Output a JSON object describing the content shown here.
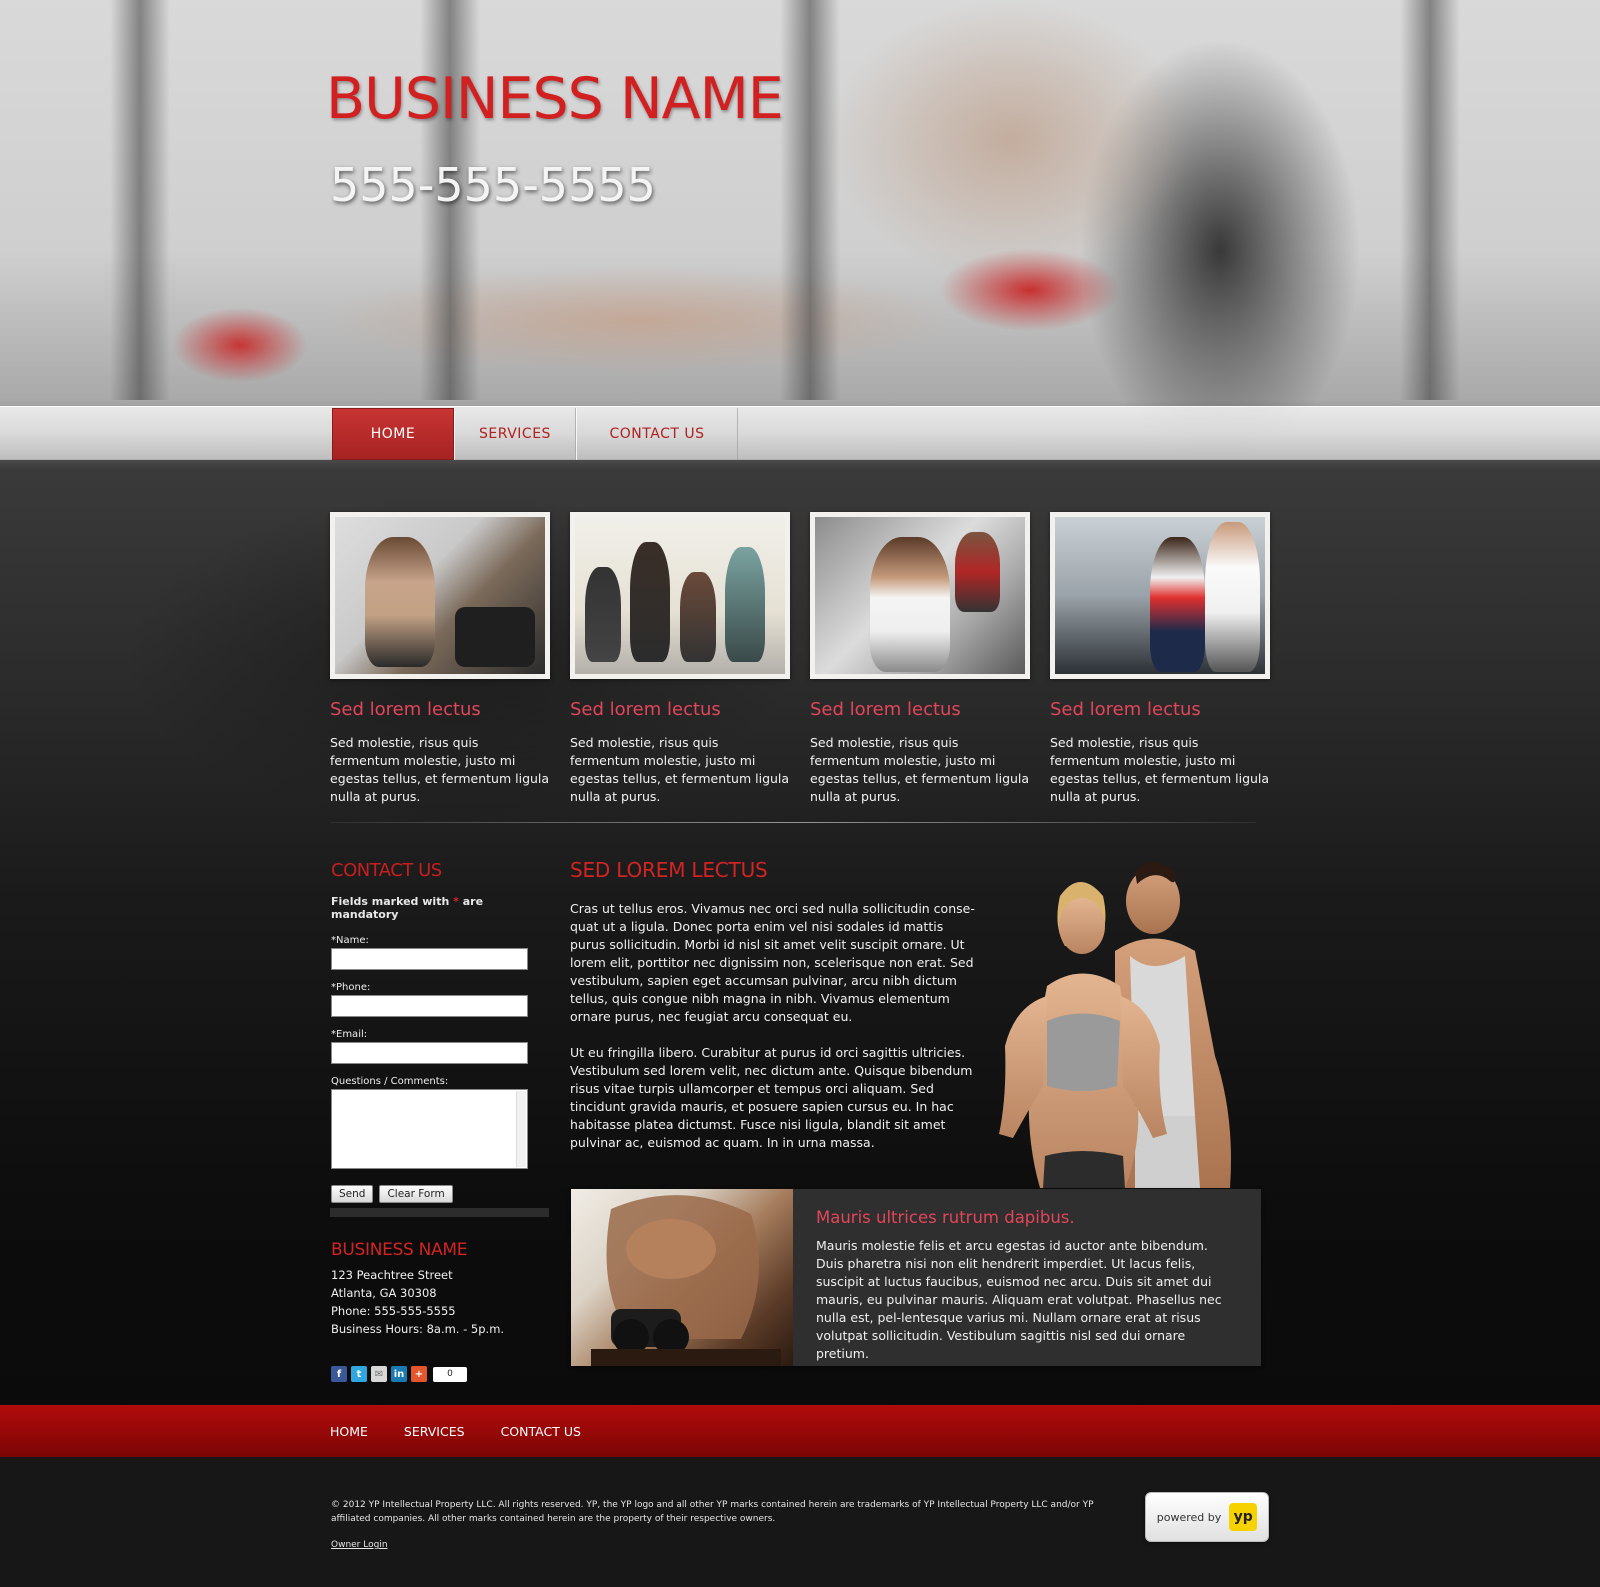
{
  "header": {
    "business_name": "BUSINESS NAME",
    "phone": "555-555-5555"
  },
  "nav": {
    "items": [
      {
        "label": "HOME",
        "active": true
      },
      {
        "label": "SERVICES",
        "active": false
      },
      {
        "label": "CONTACT US",
        "active": false
      }
    ]
  },
  "features": [
    {
      "title": "Sed lorem lectus",
      "text": "Sed molestie, risus quis fermentum molestie, justo mi egestas tellus, et fermentum ligula nulla at purus."
    },
    {
      "title": "Sed lorem lectus",
      "text": "Sed molestie, risus quis fermentum molestie, justo mi egestas tellus, et fermentum ligula nulla at purus."
    },
    {
      "title": "Sed lorem lectus",
      "text": "Sed molestie, risus quis fermentum molestie, justo mi egestas tellus, et fermentum ligula nulla at purus."
    },
    {
      "title": "Sed lorem lectus",
      "text": "Sed molestie, risus quis fermentum molestie, justo mi egestas tellus, et fermentum ligula nulla at purus."
    }
  ],
  "contact_form": {
    "heading": "CONTACT US",
    "mandatory_prefix": "Fields marked with ",
    "mandatory_star": "*",
    "mandatory_suffix": " are mandatory",
    "name_label": "*Name:",
    "phone_label": "*Phone:",
    "email_label": "*Email:",
    "comments_label": "Questions / Comments:",
    "send_label": "Send",
    "clear_label": "Clear Form"
  },
  "business_info": {
    "heading": "BUSINESS NAME",
    "street": "123 Peachtree Street",
    "city": "Atlanta, GA 30308",
    "phone": "Phone: 555-555-5555",
    "hours": "Business Hours: 8a.m. - 5p.m."
  },
  "social": {
    "icons": [
      "facebook-icon",
      "twitter-icon",
      "email-icon",
      "linkedin-icon",
      "plus-share-icon"
    ],
    "count": "0"
  },
  "article": {
    "heading": "SED LOREM LECTUS",
    "paragraph1": "Cras ut tellus eros. Vivamus nec orci sed nulla sollicitudin conse-quat ut a ligula. Donec porta enim vel nisi sodales id mattis purus sollicitudin. Morbi id nisl sit amet velit suscipit ornare. Ut lorem elit, porttitor nec dignissim non, scelerisque non erat. Sed vestibulum, sapien eget accumsan pulvinar, arcu nibh dictum tellus, quis congue nibh magna in nibh. Vivamus elementum ornare purus, nec feugiat arcu consequat eu.",
    "paragraph2": "Ut eu fringilla libero. Curabitur at purus id orci sagittis ultricies. Vestibulum sed lorem velit, nec dictum ante. Quisque bibendum risus vitae turpis ullamcorper et tempus orci aliquam. Sed tincidunt gravida mauris, et posuere sapien cursus eu. In hac habitasse platea dictumst. Fusce nisi ligula, blandit sit amet pulvinar ac, euismod ac quam. In in urna massa."
  },
  "callout": {
    "heading": "Mauris ultrices rutrum dapibus.",
    "text": "Mauris molestie felis et arcu egestas id auctor ante bibendum. Duis pharetra nisi non elit hendrerit imperdiet. Ut lacus felis, suscipit at luctus faucibus, euismod nec arcu. Duis sit amet dui mauris, eu pulvinar mauris. Aliquam erat volutpat. Phasellus nec nulla est, pel-lentesque varius mi. Nullam ornare erat at risus volutpat sollicitudin. Vestibulum sagittis nisl sed dui ornare pretium."
  },
  "footer": {
    "nav": [
      "HOME",
      "SERVICES",
      "CONTACT US"
    ],
    "legal": "© 2012 YP Intellectual Property LLC. All rights reserved. YP, the YP logo and all other YP marks contained herein are trademarks of YP Intellectual Property LLC and/or YP affiliated companies. All other marks contained herein are the property of their respective owners.",
    "owner_login": "Owner Login",
    "powered_by": "powered by",
    "powered_logo": "yp"
  },
  "colors": {
    "accent_red": "#d21f1f",
    "heading_pink": "#e3455a",
    "footer_red": "#980808",
    "yp_yellow": "#f6d200"
  }
}
